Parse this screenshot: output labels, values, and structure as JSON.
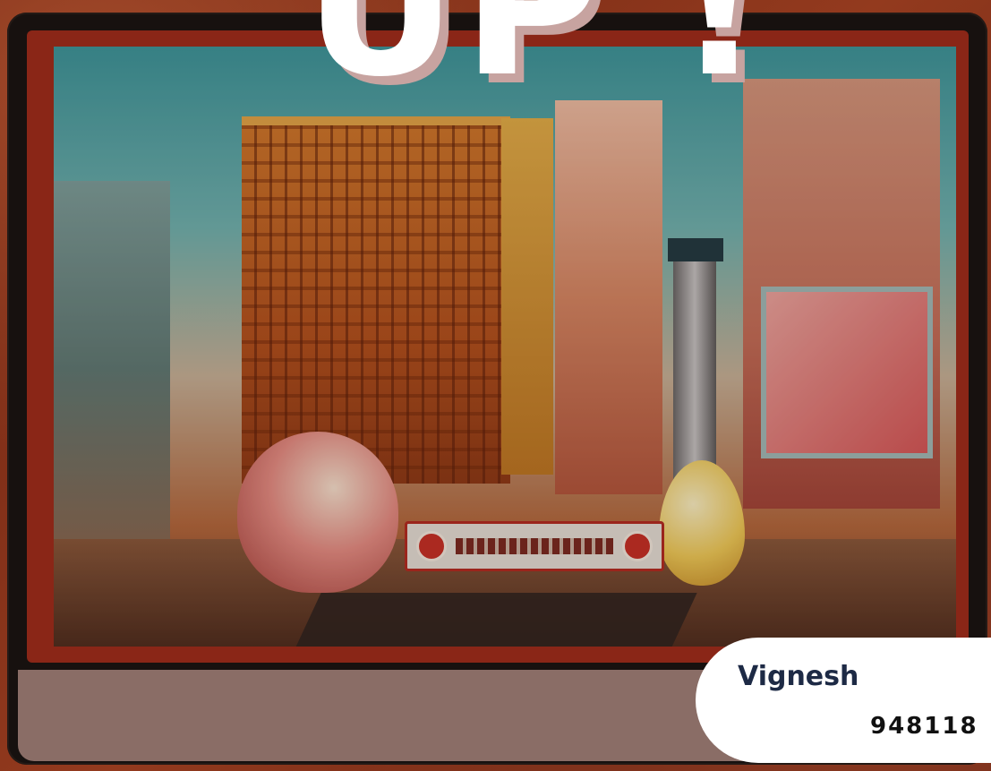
{
  "headline": {
    "text": "UP !"
  },
  "contact": {
    "name": "Vignesh",
    "phone": "948118"
  },
  "scene": {
    "sign_label": "",
    "colors": {
      "frame": "#8a2617",
      "bezel": "#17110f",
      "chin": "#8a6d66",
      "badge": "#ffffff",
      "name_text": "#1d2a45"
    }
  }
}
